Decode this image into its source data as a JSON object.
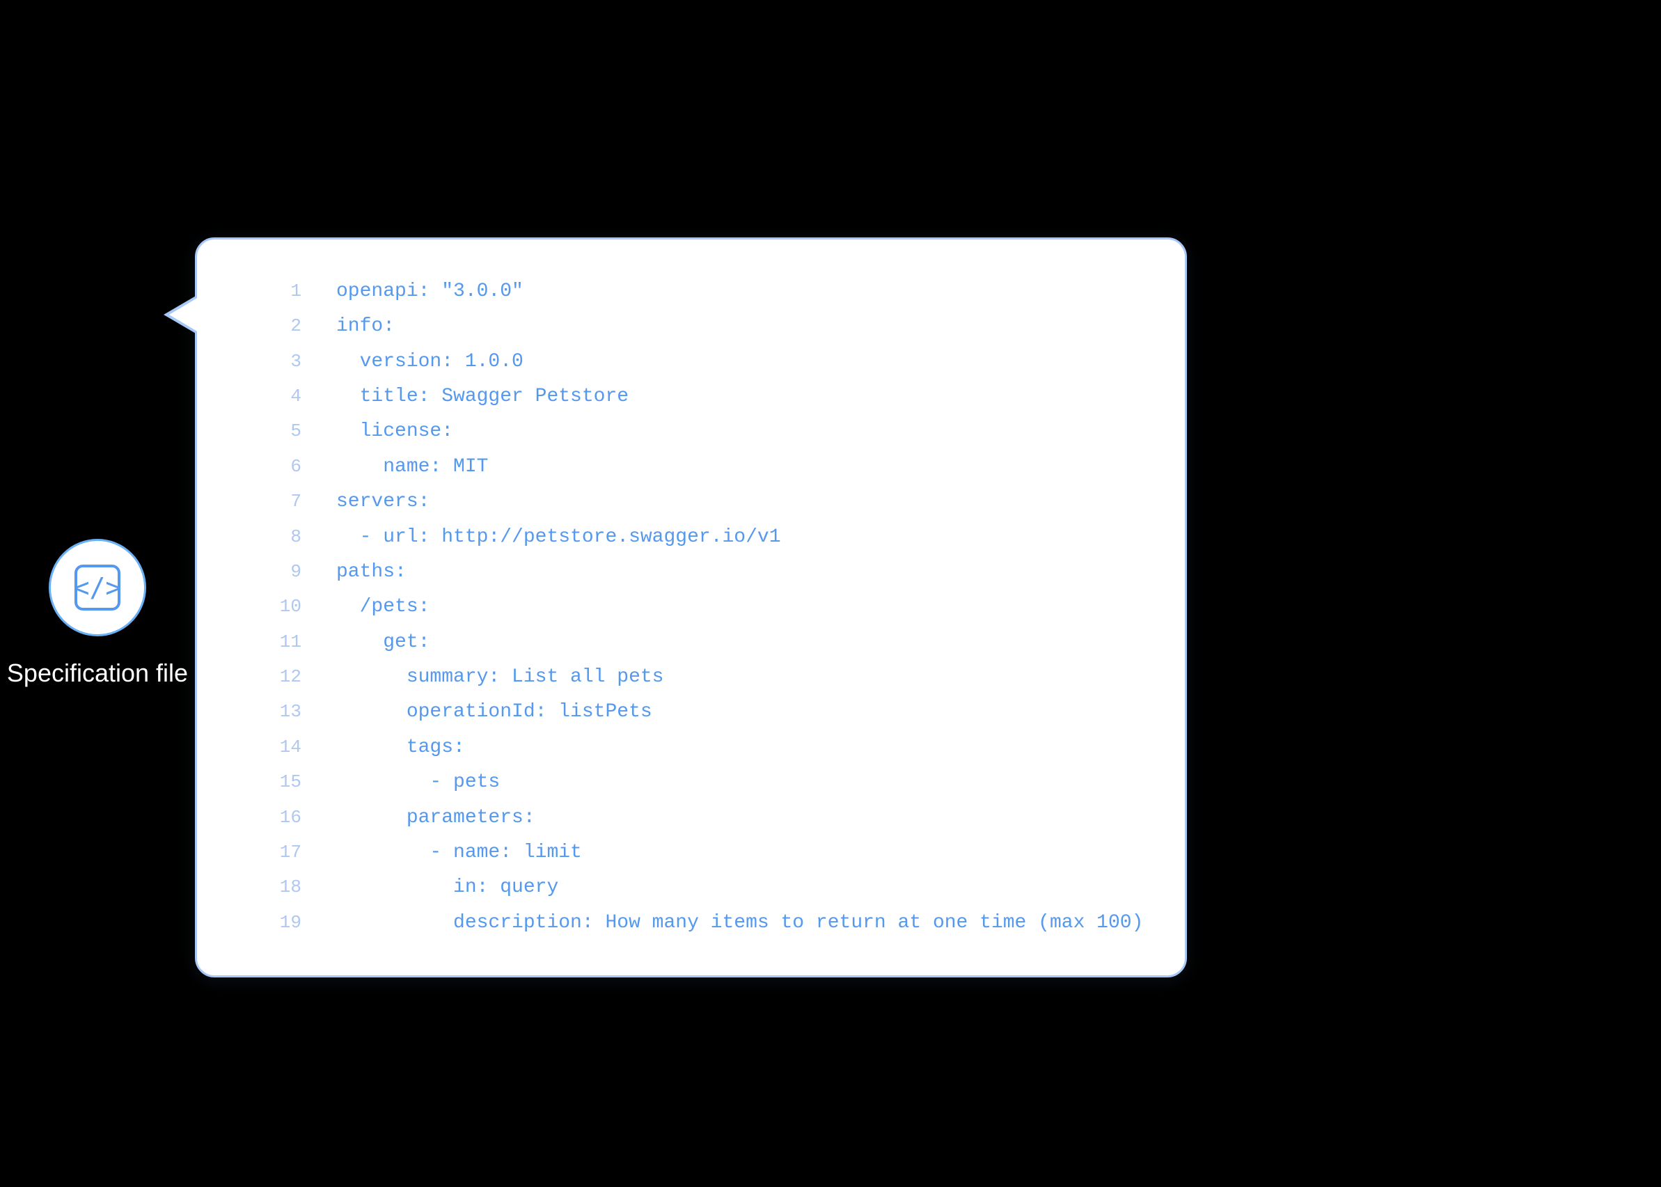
{
  "left": {
    "icon_label": "code-brackets-icon",
    "spec_label": "Specification file"
  },
  "bubble": {
    "lines": [
      {
        "num": "1",
        "indent": 0,
        "text": "openapi: \"3.0.0\""
      },
      {
        "num": "2",
        "indent": 0,
        "text": "info:"
      },
      {
        "num": "3",
        "indent": 2,
        "text": "  version: 1.0.0"
      },
      {
        "num": "4",
        "indent": 2,
        "text": "  title: Swagger Petstore"
      },
      {
        "num": "5",
        "indent": 2,
        "text": "  license:"
      },
      {
        "num": "6",
        "indent": 4,
        "text": "    name: MIT"
      },
      {
        "num": "7",
        "indent": 0,
        "text": "servers:"
      },
      {
        "num": "8",
        "indent": 2,
        "text": "  - url: http://petstore.swagger.io/v1"
      },
      {
        "num": "9",
        "indent": 0,
        "text": "paths:"
      },
      {
        "num": "10",
        "indent": 2,
        "text": "  /pets:"
      },
      {
        "num": "11",
        "indent": 4,
        "text": "    get:"
      },
      {
        "num": "12",
        "indent": 6,
        "text": "      summary: List all pets"
      },
      {
        "num": "13",
        "indent": 6,
        "text": "      operationId: listPets"
      },
      {
        "num": "14",
        "indent": 6,
        "text": "      tags:"
      },
      {
        "num": "15",
        "indent": 8,
        "text": "        - pets"
      },
      {
        "num": "16",
        "indent": 6,
        "text": "      parameters:"
      },
      {
        "num": "17",
        "indent": 8,
        "text": "        - name: limit"
      },
      {
        "num": "18",
        "indent": 10,
        "text": "          in: query"
      },
      {
        "num": "19",
        "indent": 10,
        "text": "          description: How many items to return at one time (max 100)"
      }
    ]
  },
  "colors": {
    "code_blue": "#5599ee",
    "line_num_color": "#b0c8f0",
    "bubble_border": "#a8c8f8",
    "icon_border": "#6ab0f5",
    "background": "#000000",
    "label_color": "#ffffff"
  }
}
